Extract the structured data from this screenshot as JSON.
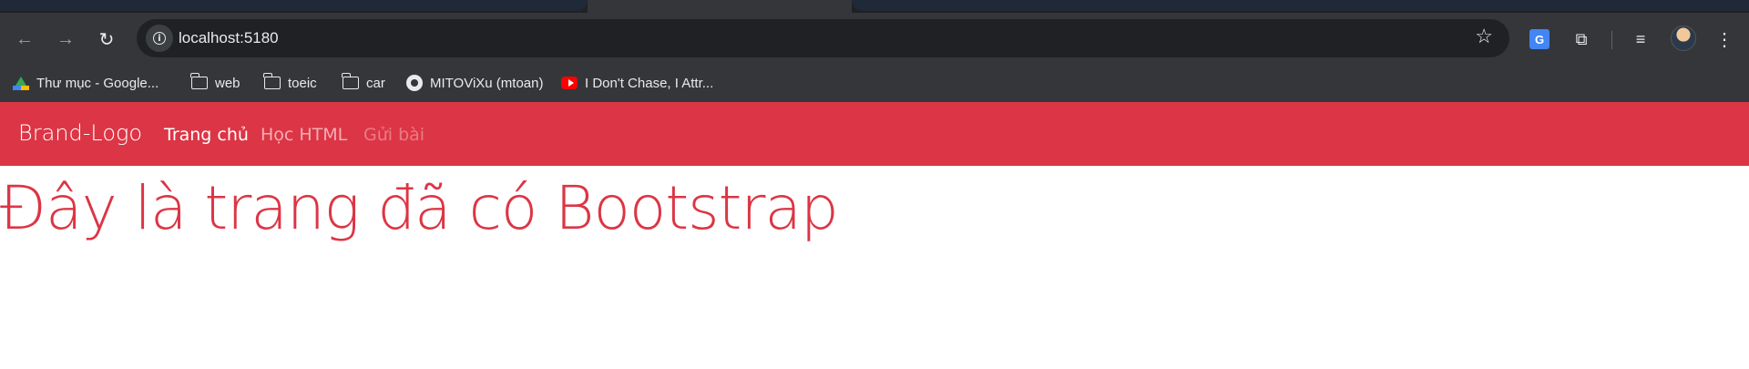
{
  "browser": {
    "url": "localhost:5180",
    "bookmarks": [
      {
        "label": "Thư mục - Google...",
        "icon": "google-drive-icon"
      },
      {
        "label": "web",
        "icon": "folder-icon"
      },
      {
        "label": "toeic",
        "icon": "folder-icon"
      },
      {
        "label": "car",
        "icon": "folder-icon"
      },
      {
        "label": "MITOViXu (mtoan)",
        "icon": "github-icon"
      },
      {
        "label": "I Don't Chase, I Attr...",
        "icon": "youtube-icon"
      }
    ],
    "icons": {
      "back": "←",
      "forward": "→",
      "reload": "↻",
      "info": "i",
      "star": "☆",
      "translate": "G",
      "extensions": "⧉",
      "media": "≡",
      "menu": "⋮"
    }
  },
  "page": {
    "navbar": {
      "brand": "Brand-Logo",
      "links": [
        {
          "label": "Trang chủ",
          "state": "active"
        },
        {
          "label": "Học HTML",
          "state": "normal"
        },
        {
          "label": "Gửi bài",
          "state": "disabled"
        }
      ],
      "color": "#dc3545"
    },
    "heading": "Đây là trang đã có Bootstrap"
  }
}
